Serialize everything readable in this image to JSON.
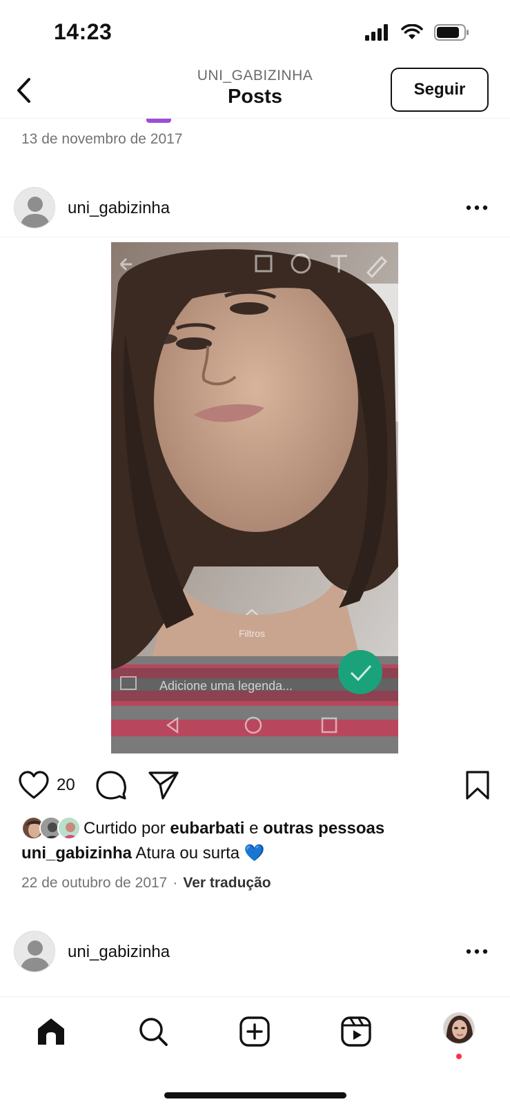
{
  "status_bar": {
    "time": "14:23",
    "icons": [
      "signal-icon",
      "wifi-icon",
      "battery-icon"
    ]
  },
  "header": {
    "subtitle": "UNI_GABIZINHA",
    "title": "Posts",
    "follow_label": "Seguir",
    "back_icon": "chevron-left-icon"
  },
  "previous_post": {
    "date": "13 de novembro de 2017"
  },
  "post": {
    "username": "uni_gabizinha",
    "more_icon": "more-horizontal-icon",
    "image_overlay": {
      "filters_label": "Filtros",
      "caption_placeholder": "Adicione uma legenda..."
    },
    "like_count": "20",
    "liked_by_prefix": "Curtido por",
    "liked_by_user": "eubarbati",
    "liked_by_joiner": "e",
    "liked_by_suffix": "outras pessoas",
    "caption_user": "uni_gabizinha",
    "caption_text": "Atura ou surta 💙",
    "date": "22 de outubro de 2017",
    "separator": "·",
    "translate_label": "Ver tradução"
  },
  "next_post": {
    "username": "uni_gabizinha"
  },
  "bottom_nav": {
    "items": [
      "home-icon",
      "search-icon",
      "create-icon",
      "reels-icon",
      "profile-avatar"
    ],
    "notification_color": "#ff3040"
  },
  "colors": {
    "accent_follow_border": "#111111",
    "muted_text": "#737373"
  }
}
